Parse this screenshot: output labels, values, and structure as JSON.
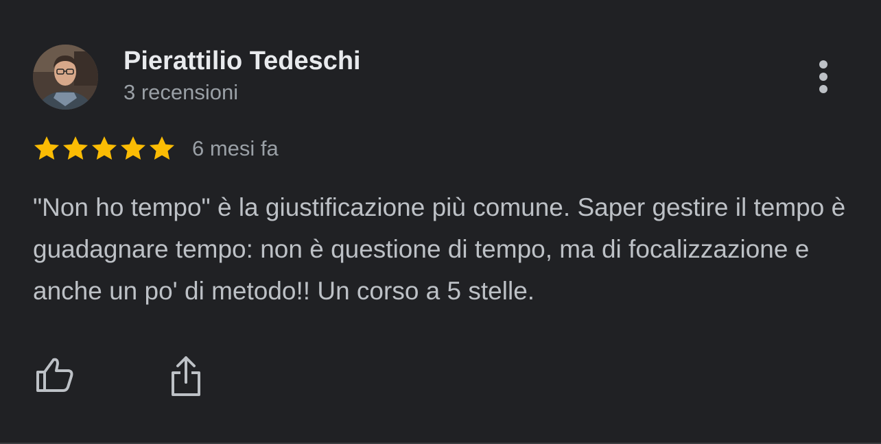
{
  "review": {
    "author": {
      "name": "Pierattilio Tedeschi",
      "review_count": "3 recensioni"
    },
    "rating": {
      "stars": 5,
      "max": 5,
      "color": "#fbbc04"
    },
    "time": "6 mesi fa",
    "text": "\"Non ho tempo\" è la giustificazione più comune. Saper gestire il tempo è guadagnare tempo: non è questione di tempo, ma di focalizzazione e anche un po' di metodo!! Un corso a 5 stelle."
  },
  "icons": {
    "more": "more-vert-icon",
    "like": "thumb-up-icon",
    "share": "share-icon"
  },
  "colors": {
    "background": "#202124",
    "name_text": "#e8eaed",
    "secondary_text": "#9aa0a6",
    "body_text": "#bdc1c6",
    "icon": "#bdc1c6"
  }
}
